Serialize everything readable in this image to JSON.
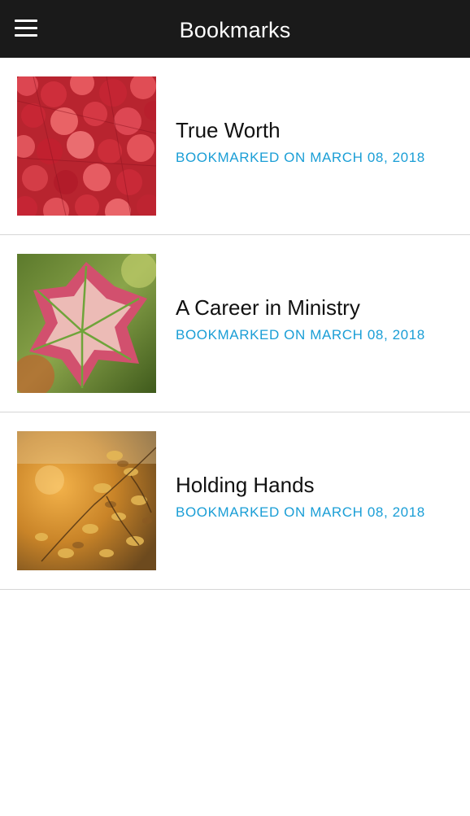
{
  "header": {
    "title": "Bookmarks",
    "menu_icon": "hamburger-menu-icon"
  },
  "colors": {
    "header_bg": "#1a1a1a",
    "accent": "#1a9ed6",
    "divider": "#d6d6d6"
  },
  "bookmarks": [
    {
      "title": "True Worth",
      "date_label": "BOOKMARKED ON MARCH 08, 2018",
      "thumbnail": "red-ivy-leaves-image"
    },
    {
      "title": "A Career in Ministry",
      "date_label": "BOOKMARKED ON MARCH 08, 2018",
      "thumbnail": "autumn-vine-leaf-image"
    },
    {
      "title": "Holding Hands",
      "date_label": "BOOKMARKED ON MARCH 08, 2018",
      "thumbnail": "golden-autumn-branch-image"
    }
  ]
}
